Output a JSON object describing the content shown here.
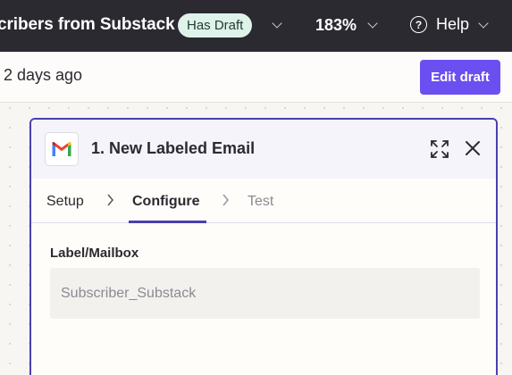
{
  "topbar": {
    "zap_title": "cribers from Substack",
    "draft_badge": "Has Draft",
    "zoom": "183%",
    "help_label": "Help"
  },
  "subbar": {
    "edited_text": "2 days ago",
    "edit_draft_label": "Edit draft"
  },
  "step": {
    "title": "1. New Labeled Email",
    "app_icon": "gmail-logo",
    "tabs": [
      {
        "label": "Setup",
        "state": "done"
      },
      {
        "label": "Configure",
        "state": "active"
      },
      {
        "label": "Test",
        "state": "disabled"
      }
    ],
    "field": {
      "label": "Label/Mailbox",
      "value": "Subscriber_Substack"
    }
  },
  "colors": {
    "accent": "#4a3fb0",
    "button": "#6b4ff0",
    "badge_bg": "#dff3ea",
    "topbar_bg": "#2b2a30"
  }
}
